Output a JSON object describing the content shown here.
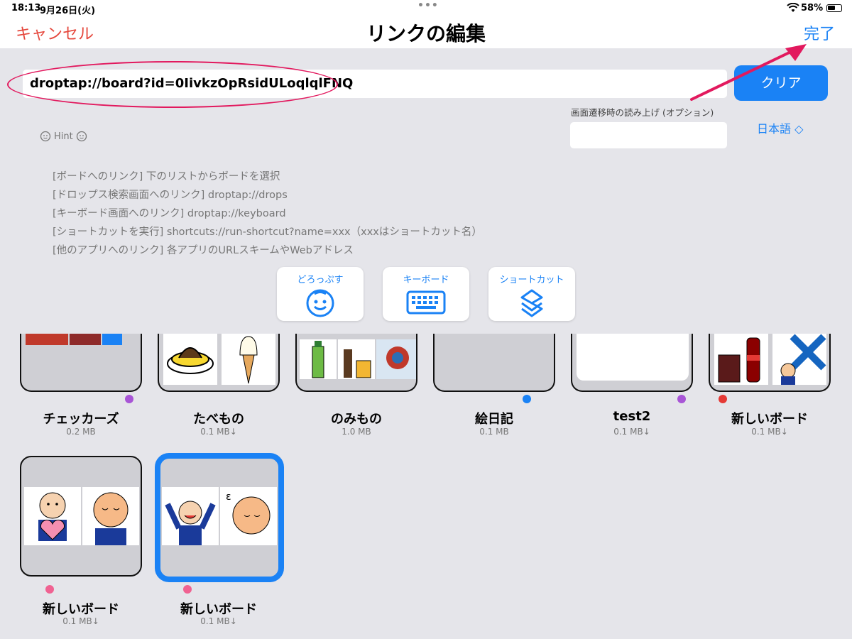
{
  "status": {
    "time": "18:13",
    "date": "9月26日(火)",
    "battery": "58%"
  },
  "nav": {
    "cancel": "キャンセル",
    "title": "リンクの編集",
    "done": "完了"
  },
  "editor": {
    "url_value": "droptap://board?id=0IivkzOpRsidULoqlqlFNQ",
    "clear_label": "クリア",
    "speech_label": "画面遷移時の読み上げ (オプション)",
    "speech_value": "",
    "language": "日本語 ◇",
    "hint_label": "Hint",
    "hints": [
      "[ボードへのリンク] 下のリストからボードを選択",
      "[ドロップス検索画面へのリンク] droptap://drops",
      "[キーボード画面へのリンク] droptap://keyboard",
      "[ショートカットを実行] shortcuts://run-shortcut?name=xxx（xxxはショートカット名）",
      "[他のアプリへのリンク] 各アプリのURLスキームやWebアドレス"
    ],
    "quick_buttons": [
      {
        "label": "どろっぷす",
        "icon": "smiley-face-icon"
      },
      {
        "label": "キーボード",
        "icon": "keyboard-icon"
      },
      {
        "label": "ショートカット",
        "icon": "shortcuts-icon"
      }
    ]
  },
  "boards_row1": [
    {
      "name": "チェッカーズ",
      "size": "0.2 MB",
      "dot": "#a855d6"
    },
    {
      "name": "たべもの",
      "size": "0.1 MB↓",
      "dot": ""
    },
    {
      "name": "のみもの",
      "size": "1.0 MB",
      "dot": ""
    },
    {
      "name": "絵日記",
      "size": "0.1 MB",
      "dot": "#1a82f5"
    },
    {
      "name": "test2",
      "size": "0.1 MB↓",
      "dot": "#a855d6"
    },
    {
      "name": "新しいボード",
      "size": "0.1 MB↓",
      "dot": "#e53935"
    }
  ],
  "boards_row2": [
    {
      "name": "新しいボード",
      "size": "0.1 MB↓",
      "dot": "#f06292",
      "selected": false
    },
    {
      "name": "新しいボード",
      "size": "0.1 MB↓",
      "dot": "#f06292",
      "selected": true
    }
  ],
  "colors": {
    "accent": "#1a82f5",
    "cancel": "#e5483d",
    "highlight": "#e2195e"
  }
}
